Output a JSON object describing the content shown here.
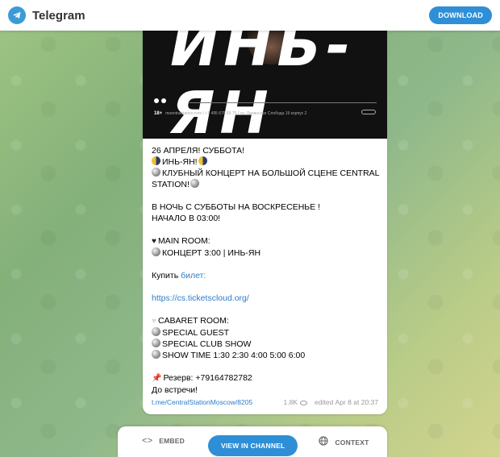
{
  "header": {
    "brand": "Telegram",
    "download_label": "DOWNLOAD"
  },
  "poster": {
    "big_text": "ИНЬ-ЯН",
    "age_badge": "18+",
    "info_line": "moentralstation.com / +7 495 675 69 75 / ул. Ланинская Слобода 19 корпус 2"
  },
  "post": {
    "lines": [
      "26 АПРЕЛЯ! СУББОТА!",
      "ИНЬ-ЯН!",
      "КЛУБНЫЙ КОНЦЕРТ НА БОЛЬШОЙ СЦЕНЕ CENTRAL",
      "STATION!",
      "",
      "В НОЧЬ С СУББОТЫ НА ВОСКРЕСЕНЬЕ !",
      "НАЧАЛО В 03:00!",
      "",
      "MAIN ROOM:",
      "КОНЦЕРТ 3:00 | ИНЬ-ЯН",
      "",
      "Купить",
      "",
      "",
      "",
      "CABARET ROOM:",
      "SPECIAL GUEST",
      "SPECIAL CLUB SHOW",
      "SHOW TIME 1:30 2:30 4:00 5:00 6:00",
      "",
      "Резерв: +79164782782",
      "До встречи!"
    ],
    "buy_link_label": "билет:",
    "ticket_url": "https://cs.ticketscloud.org/"
  },
  "meta": {
    "post_link": "t.me/CentralStationMoscow/8205",
    "views": "1.8K",
    "edited_label": "edited",
    "date": "Apr 8 at 20:37"
  },
  "footer": {
    "embed_label": "EMBED",
    "view_label": "VIEW IN CHANNEL",
    "context_label": "CONTEXT"
  },
  "colors": {
    "accent": "#2e8fd7",
    "link": "#2a7dc8"
  },
  "icons": [
    "telegram-logo-icon",
    "eye-icon",
    "code-icon",
    "globe-icon",
    "yin-yang-icon",
    "disco-ball-icon",
    "black-heart-icon",
    "white-heart-icon",
    "pushpin-icon"
  ]
}
